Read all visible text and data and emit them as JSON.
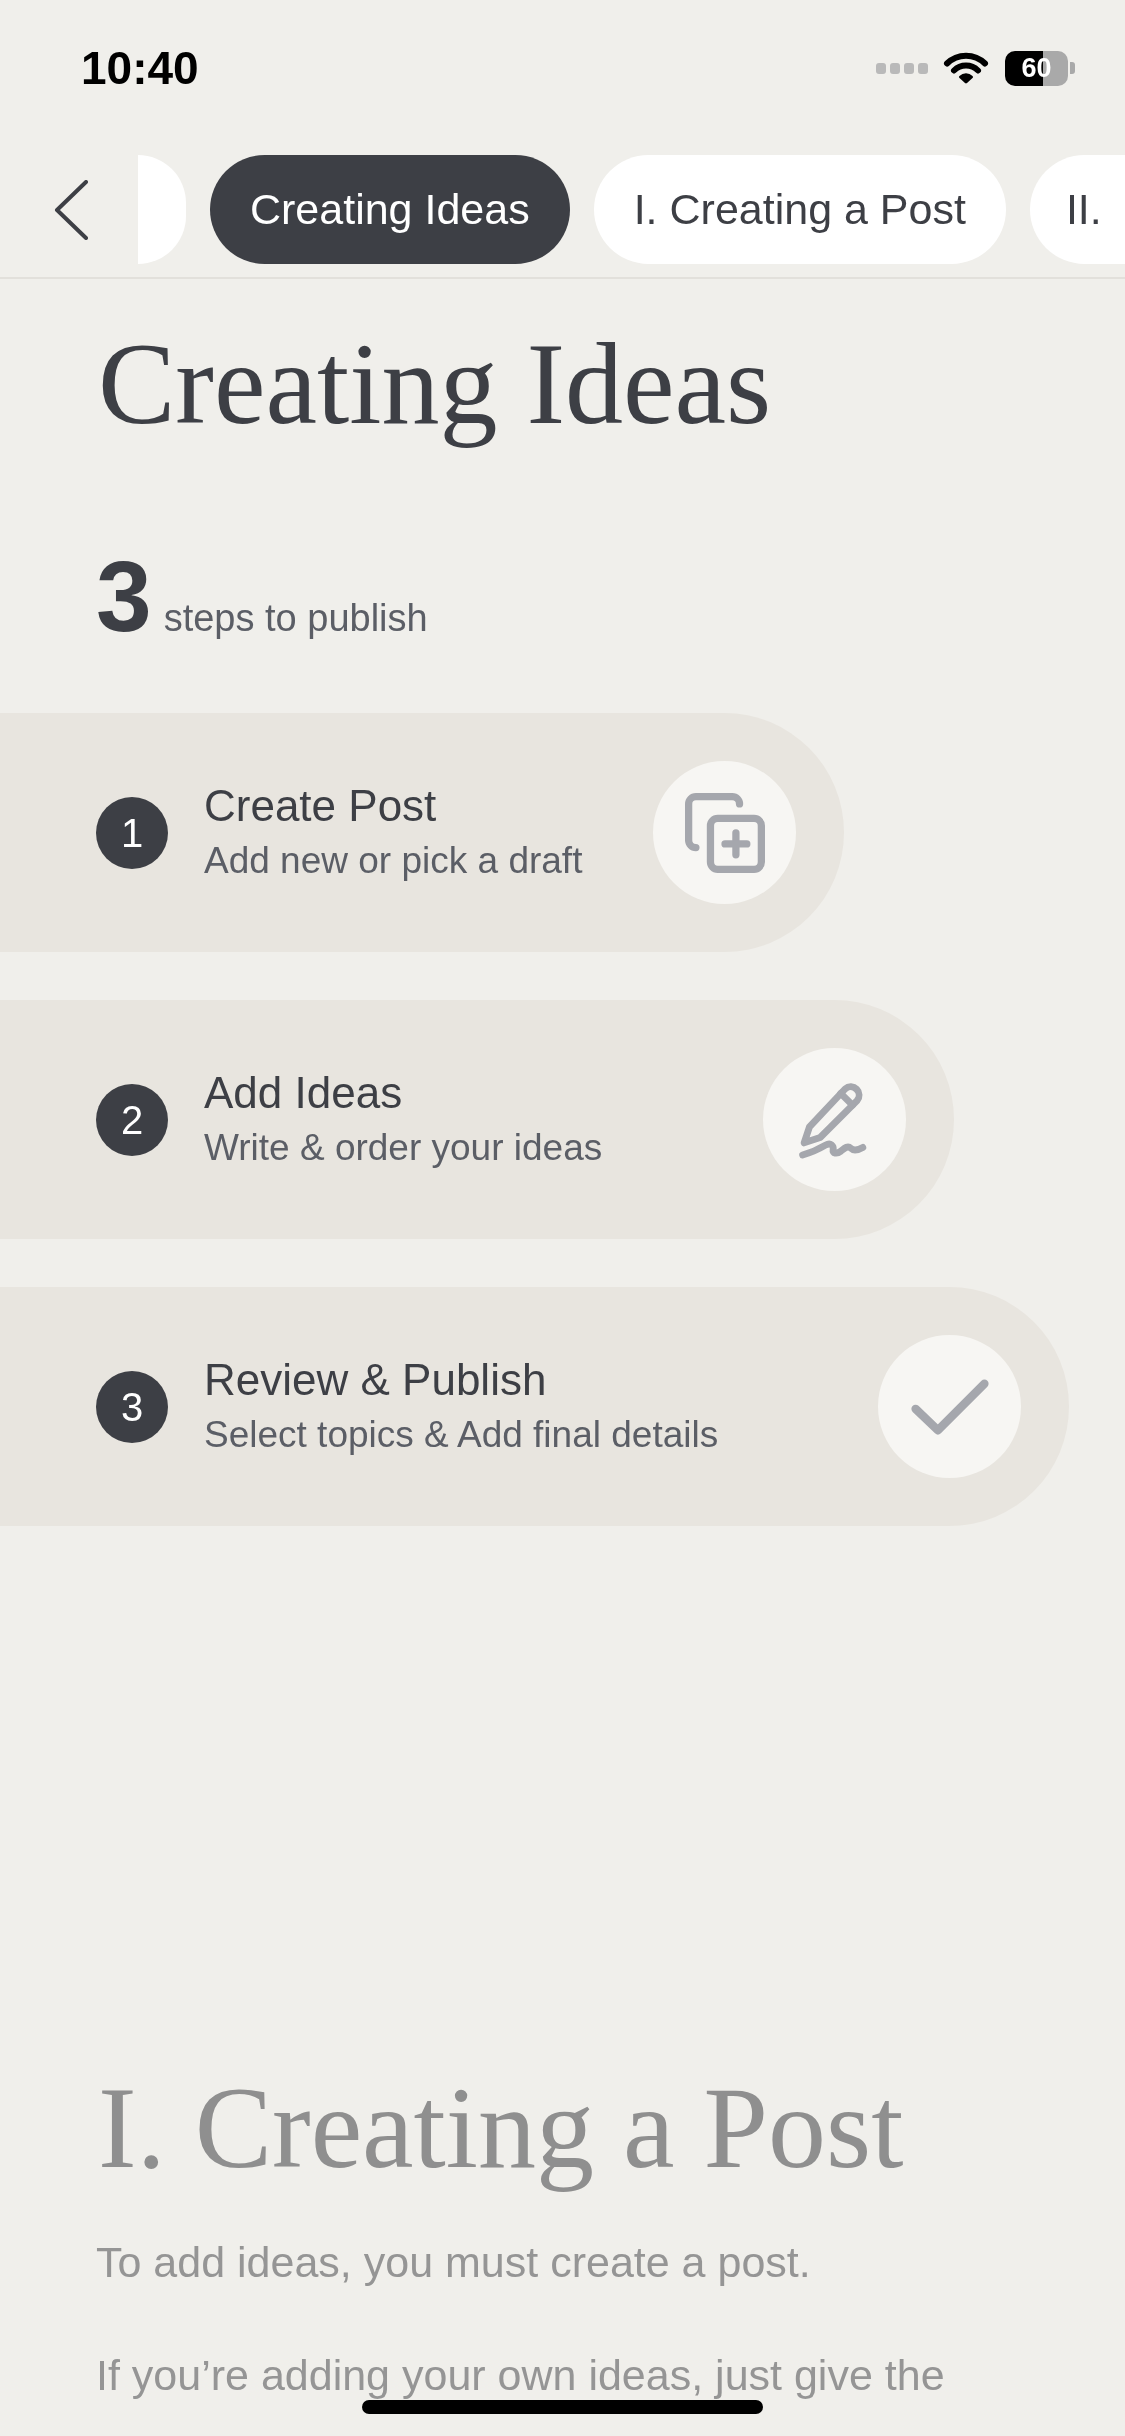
{
  "status_bar": {
    "time": "10:40",
    "battery_percent": "60"
  },
  "tabs": [
    {
      "selected": false
    },
    {
      "label": "Creating Ideas",
      "selected": true
    },
    {
      "label": "I. Creating a Post",
      "selected": false
    },
    {
      "label": "II.",
      "selected": false
    }
  ],
  "title": "Creating Ideas",
  "steps_summary": {
    "count": "3",
    "caption": "steps to publish"
  },
  "steps": [
    {
      "number": "1",
      "title": "Create Post",
      "subtitle": "Add new or pick a draft"
    },
    {
      "number": "2",
      "title": "Add Ideas",
      "subtitle": "Write & order your ideas"
    },
    {
      "number": "3",
      "title": "Review & Publish",
      "subtitle": "Select topics & Add final details"
    }
  ],
  "next_section": {
    "title": "I. Creating a Post",
    "paragraphs": [
      "To add ideas, you must create a post.",
      "If you’re adding your own ideas, just give the"
    ]
  }
}
